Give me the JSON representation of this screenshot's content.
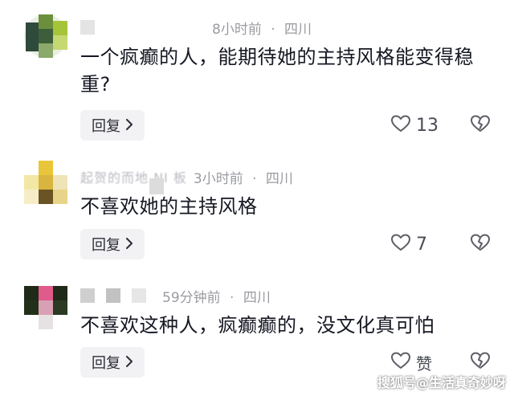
{
  "comments": [
    {
      "time": "8小时前",
      "location": "四川",
      "text": "一个疯癫的人，能期待她的主持风格能变得稳重?",
      "reply_label": "回复",
      "like_count": "13"
    },
    {
      "name_blurred": "起贺的而地 NI 板",
      "time": "3小时前",
      "location": "四川",
      "text": "不喜欢她的主持风格",
      "reply_label": "回复",
      "like_count": "7"
    },
    {
      "time": "59分钟前",
      "location": "四川",
      "text": "不喜欢这种人，疯癫癫的，没文化真可怕",
      "reply_label": "回复",
      "like_count": "赞"
    }
  ],
  "separator": "·",
  "icons": {
    "like": "heart-outline-icon",
    "dislike": "broken-heart-icon",
    "reply_chevron": "chevron-right-icon"
  },
  "watermark": "搜狐号@生活真奇妙呀"
}
